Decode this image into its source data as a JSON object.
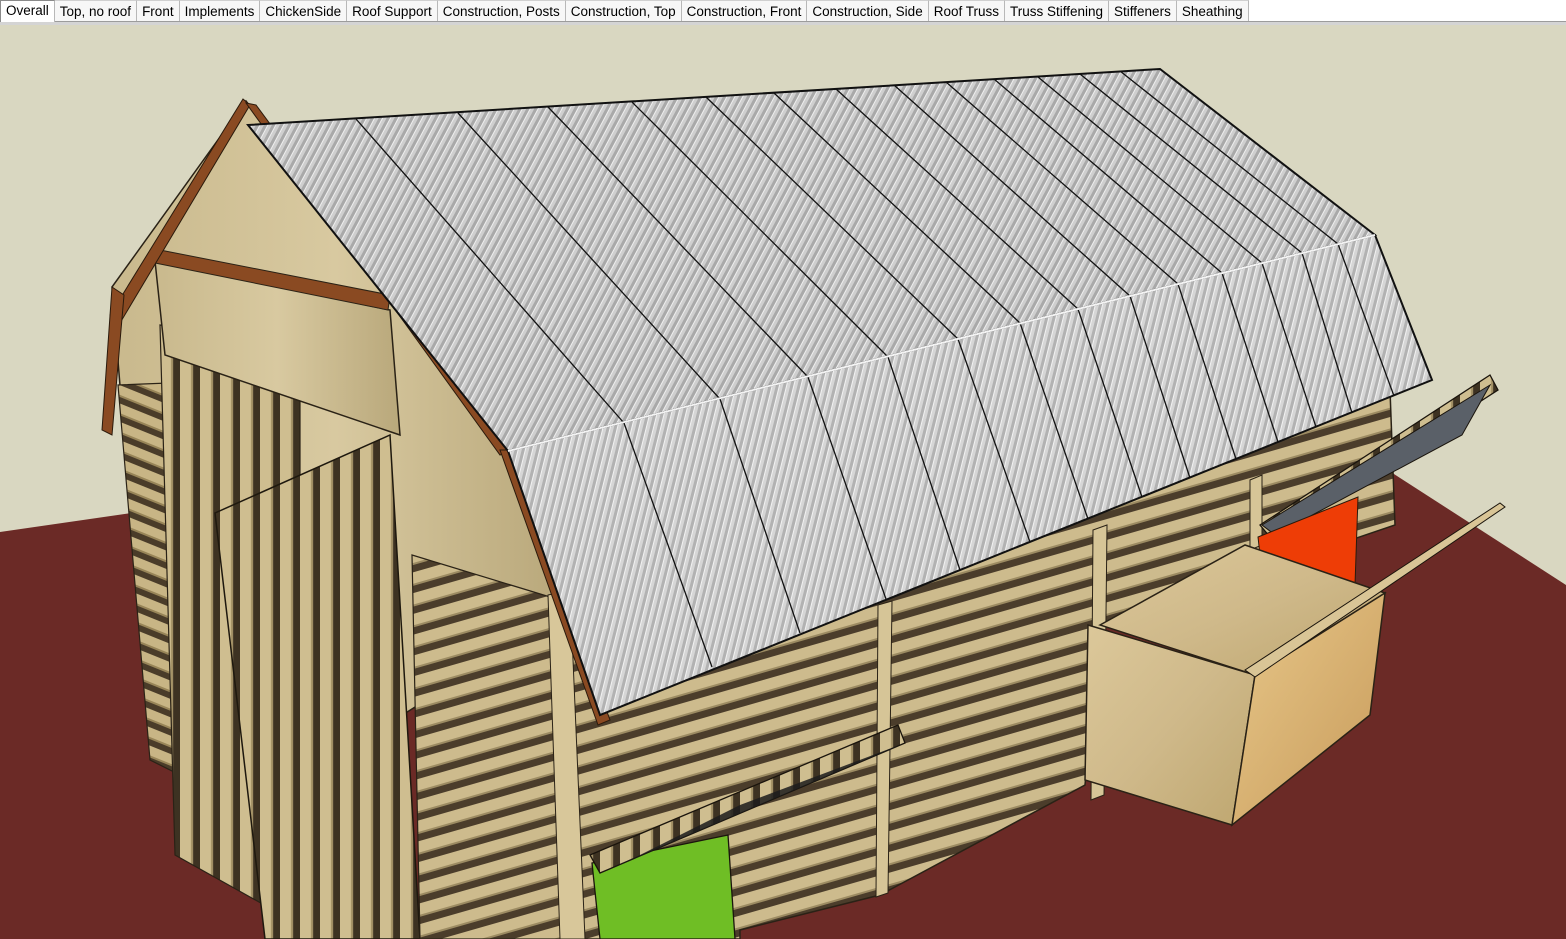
{
  "scene_tabs": [
    {
      "label": "Overall",
      "active": true
    },
    {
      "label": "Top, no roof"
    },
    {
      "label": "Front"
    },
    {
      "label": "Implements"
    },
    {
      "label": "ChickenSide"
    },
    {
      "label": "Roof Support"
    },
    {
      "label": "Construction, Posts"
    },
    {
      "label": "Construction, Top"
    },
    {
      "label": "Construction, Front"
    },
    {
      "label": "Construction, Side"
    },
    {
      "label": "Roof Truss"
    },
    {
      "label": "Truss Stiffening"
    },
    {
      "label": "Stiffeners"
    },
    {
      "label": "Sheathing"
    }
  ],
  "colors": {
    "sky": "#d9d7c1",
    "ground": "#6b2a26",
    "roof_metal": "#c8c8c8",
    "pallet_wood": "#c9b88a",
    "fascia": "#8a4a22",
    "door_green": "#6fbe25",
    "door_orange": "#ee3d06"
  }
}
